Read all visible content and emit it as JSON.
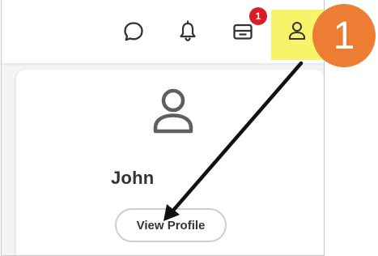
{
  "header": {
    "inbox_badge_count": "1",
    "icons": [
      "chat-icon",
      "bell-icon",
      "inbox-icon",
      "user-icon"
    ]
  },
  "profile_card": {
    "name": "John",
    "view_profile_label": "View Profile"
  },
  "annotation": {
    "step_number": "1",
    "highlight_color": "#f7f46a",
    "circle_color": "#ec7d33"
  }
}
